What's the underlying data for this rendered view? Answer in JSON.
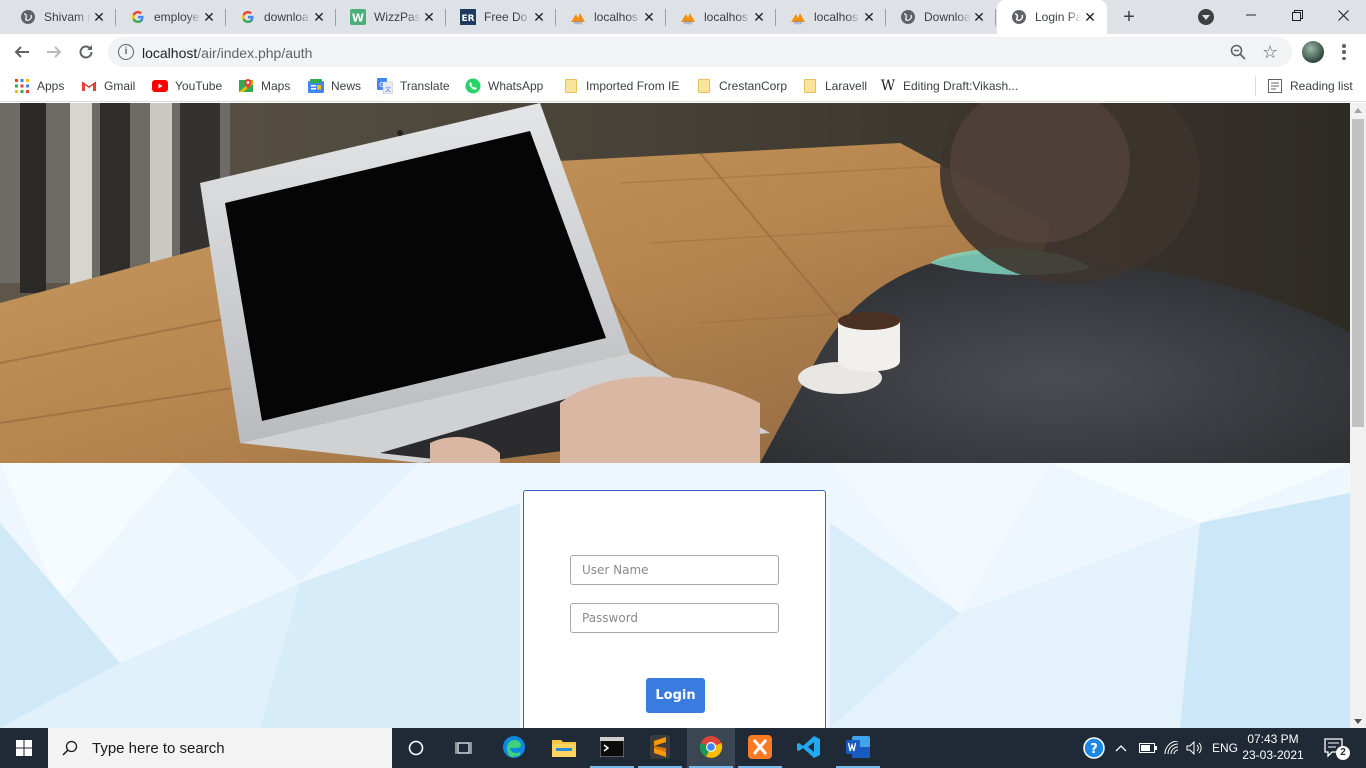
{
  "browser": {
    "tabs": [
      {
        "title": "Shivam r",
        "favicon": "globe-icon"
      },
      {
        "title": "employe",
        "favicon": "google-icon"
      },
      {
        "title": "downloa",
        "favicon": "google-icon"
      },
      {
        "title": "WizzPas",
        "favicon": "wizzpass-icon"
      },
      {
        "title": "Free Do",
        "favicon": "er-icon"
      },
      {
        "title": "localhos",
        "favicon": "phpmyadmin-icon"
      },
      {
        "title": "localhos",
        "favicon": "phpmyadmin-icon"
      },
      {
        "title": "localhos",
        "favicon": "phpmyadmin-icon"
      },
      {
        "title": "Downloa",
        "favicon": "globe-icon"
      },
      {
        "title": "Login Pa",
        "favicon": "globe-icon",
        "active": true
      }
    ],
    "address": {
      "host": "localhost",
      "path": "/air/index.php/auth"
    },
    "bookmarks": [
      {
        "label": "Apps",
        "icon": "apps-grid-icon"
      },
      {
        "label": "Gmail",
        "icon": "gmail-icon"
      },
      {
        "label": "YouTube",
        "icon": "youtube-icon"
      },
      {
        "label": "Maps",
        "icon": "maps-icon"
      },
      {
        "label": "News",
        "icon": "news-icon"
      },
      {
        "label": "Translate",
        "icon": "translate-icon"
      },
      {
        "label": "WhatsApp",
        "icon": "whatsapp-icon"
      },
      {
        "label": "Imported From IE",
        "icon": "folder-icon"
      },
      {
        "label": "CrestanCorp",
        "icon": "folder-icon"
      },
      {
        "label": "Laravell",
        "icon": "folder-icon"
      },
      {
        "label": "Editing Draft:Vikash...",
        "icon": "wikipedia-icon"
      }
    ],
    "reading_list": "Reading list"
  },
  "login": {
    "username_placeholder": "User Name",
    "password_placeholder": "Password",
    "username_value": "",
    "password_value": "",
    "button_label": "Login",
    "button_color": "#3a7be0",
    "box_border_color": "#2a6bc7"
  },
  "taskbar": {
    "search_placeholder": "Type here to search",
    "language": "ENG",
    "time": "07:43 PM",
    "date": "23-03-2021",
    "notification_count": "2"
  }
}
